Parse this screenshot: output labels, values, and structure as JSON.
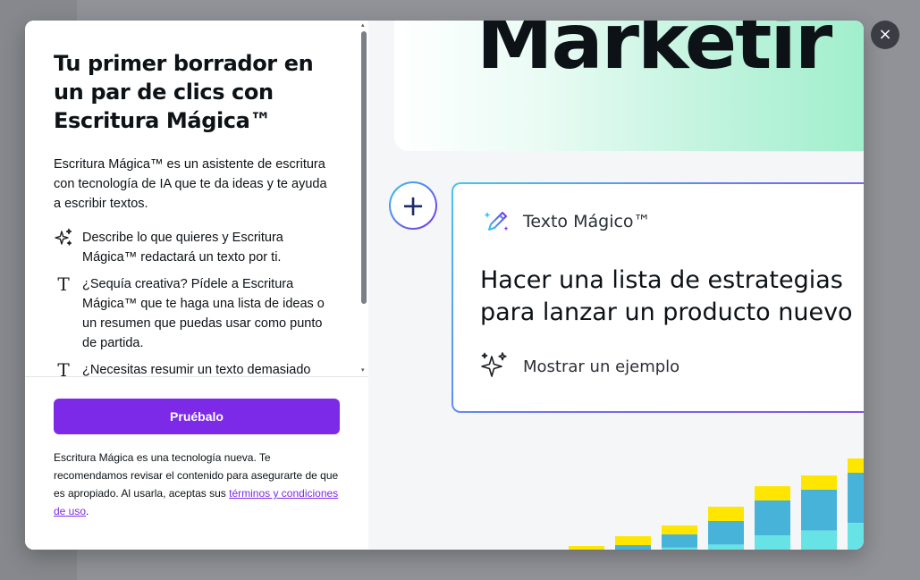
{
  "modal": {
    "title": "Tu primer borrador en un par de clics con Escritura Mágica™",
    "intro": "Escritura Mágica™ es un asistente de escritura con tecnología de IA que te da ideas y te ayuda a escribir textos.",
    "features": [
      {
        "icon": "sparkles-icon",
        "text": "Describe lo que quieres y Escritura Mágica™ redactará un texto por ti."
      },
      {
        "icon": "text-icon",
        "text": "¿Sequía creativa? Pídele a Escritura Mágica™ que te haga una lista de ideas o un resumen que puedas usar como punto de partida."
      },
      {
        "icon": "text-icon",
        "text": "¿Necesitas resumir un texto demasiado"
      }
    ],
    "cta_label": "Pruébalo",
    "disclaimer_text": "Escritura Mágica es una tecnología nueva. Te recomendamos revisar el contenido para asegurarte de que es apropiado. Al usarla, aceptas sus ",
    "disclaimer_link": "términos y condiciones de uso",
    "disclaimer_end": ".",
    "close_label": "×"
  },
  "illustration": {
    "heading_word": "Marketir",
    "magic_text_label": "Texto Mágico™",
    "prompt": "Hacer una lista de estrategias para lanzar un producto nuevo",
    "example_label": "Mostrar un ejemplo",
    "plus_symbol": "+"
  },
  "colors": {
    "accent": "#7d2ae8",
    "bar_yellow": "#ffe600",
    "bar_blue": "#48b3d9",
    "bar_cyan": "#67e3e6"
  }
}
